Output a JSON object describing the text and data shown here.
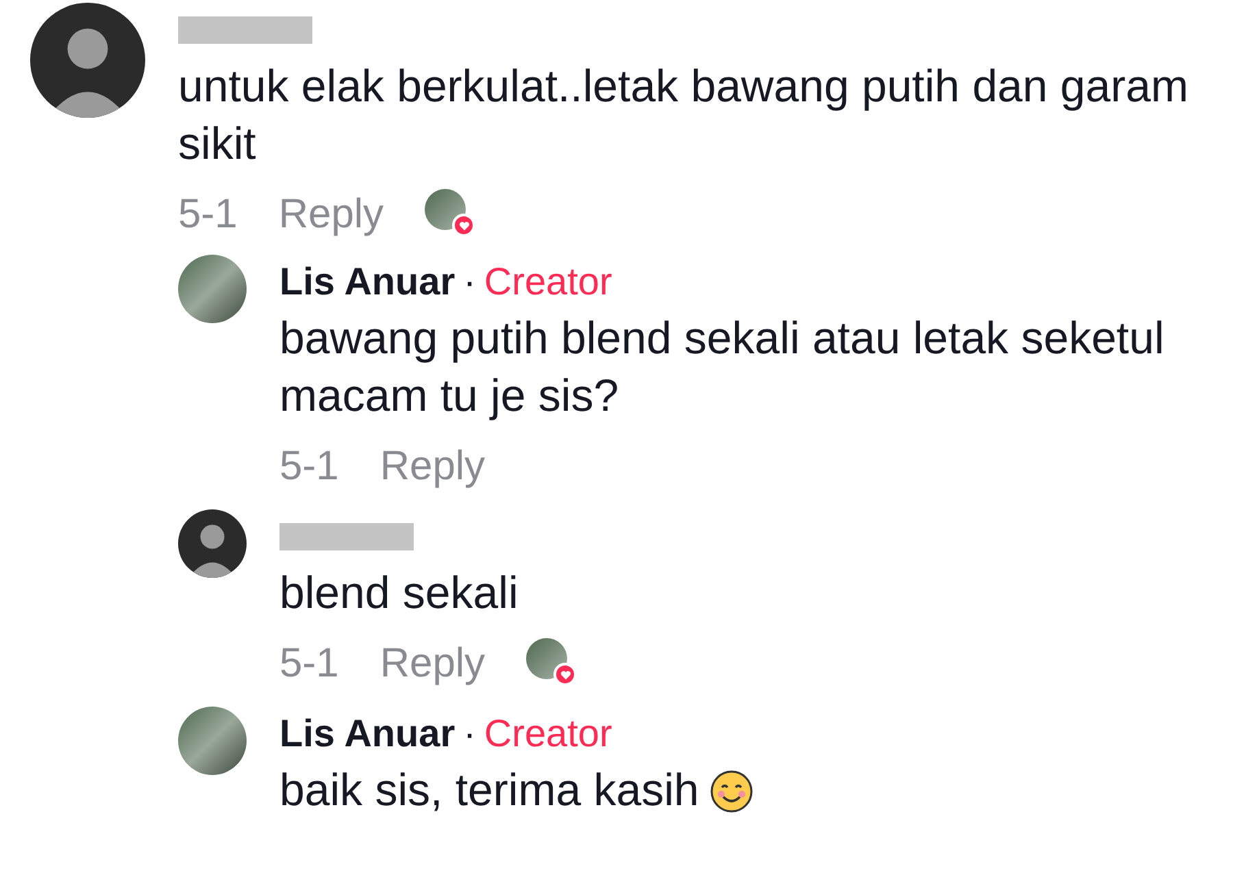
{
  "comment": {
    "author_redacted": true,
    "creator": false,
    "text": "untuk elak berkulat..letak bawang putih dan garam sikit",
    "date": "5-1",
    "reply": "Reply",
    "liked_by_creator": true,
    "smile_emoji": false,
    "replies": [
      {
        "author": "Lis Anuar",
        "author_redacted": false,
        "creator": true,
        "separator": "·",
        "badge": "Creator",
        "text": "bawang putih blend sekali atau letak seketul macam tu je sis?",
        "date": "5-1",
        "reply": "Reply",
        "liked_by_creator": false,
        "smile_emoji": false
      },
      {
        "author_redacted": true,
        "creator": false,
        "text": "blend sekali",
        "date": "5-1",
        "reply": "Reply",
        "liked_by_creator": true,
        "smile_emoji": false
      },
      {
        "author": "Lis Anuar",
        "author_redacted": false,
        "creator": true,
        "separator": "·",
        "badge": "Creator",
        "text": "baik sis, terima kasih",
        "liked_by_creator": false,
        "smile_emoji": true
      }
    ]
  }
}
